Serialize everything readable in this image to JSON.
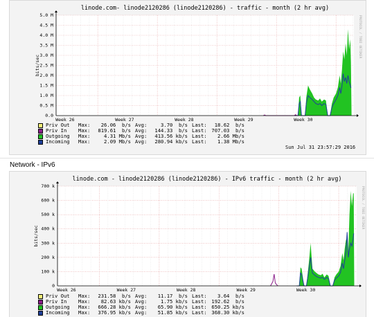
{
  "section_label": "Network - IPv6",
  "charts": [
    {
      "title": "linode.com- linode2120286 (linode2120286) - traffic - month (2 hr avg)",
      "side_text": "PROTOCOL / TOBI OETIKER",
      "ylabel": "bits/sec",
      "yticks": [
        "0.0",
        "0.5 M",
        "1.0 M",
        "1.5 M",
        "2.0 M",
        "2.5 M",
        "3.0 M",
        "3.5 M",
        "4.0 M",
        "4.5 M",
        "5.0 M"
      ],
      "xticks": [
        "Week 26",
        "Week 27",
        "Week 28",
        "Week 29",
        "Week 30"
      ],
      "timestamp": "Sun Jul 31 23:57:29 2016",
      "legend": [
        {
          "name": "Priv Out",
          "color": "#f5f27a",
          "max_k": "Max:",
          "max": "26.06  b/s",
          "avg_k": "Avg:",
          "avg": "3.70  b/s",
          "last_k": "Last:",
          "last": "18.62  b/s"
        },
        {
          "name": "Priv In",
          "color": "#8b1c88",
          "max_k": "Max:",
          "max": "819.61  b/s",
          "avg_k": "Avg:",
          "avg": "144.33  b/s",
          "last_k": "Last:",
          "last": "707.03  b/s"
        },
        {
          "name": "Outgoing",
          "color": "#22c322",
          "max_k": "Max:",
          "max": "4.31 Mb/s",
          "avg_k": "Avg:",
          "avg": "413.56 kb/s",
          "last_k": "Last:",
          "last": "2.66 Mb/s"
        },
        {
          "name": "Incoming",
          "color": "#1f3f9a",
          "max_k": "Max:",
          "max": "2.09 Mb/s",
          "avg_k": "Avg:",
          "avg": "280.94 kb/s",
          "last_k": "Last:",
          "last": "1.38 Mb/s"
        }
      ]
    },
    {
      "title": "linode.com - linode2120286 (linode2120286) - IPv6 traffic - month (2 hr avg)",
      "side_text": "PROTOCOL / TOBI OETIKER",
      "ylabel": "bits/sec",
      "yticks": [
        "0",
        "100 k",
        "200 k",
        "300 k",
        "400 k",
        "500 k",
        "600 k",
        "700 k"
      ],
      "xticks": [
        "Week 26",
        "Week 27",
        "Week 28",
        "Week 29",
        "Week 30"
      ],
      "timestamp": "",
      "legend": [
        {
          "name": "Priv Out",
          "color": "#f5f27a",
          "max_k": "Max:",
          "max": "231.58  b/s",
          "avg_k": "Avg:",
          "avg": "11.17  b/s",
          "last_k": "Last:",
          "last": "3.64  b/s"
        },
        {
          "name": "Priv In",
          "color": "#8b1c88",
          "max_k": "Max:",
          "max": "82.63 kb/s",
          "avg_k": "Avg:",
          "avg": "1.75 kb/s",
          "last_k": "Last:",
          "last": "192.62  b/s"
        },
        {
          "name": "Outgoing",
          "color": "#22c322",
          "max_k": "Max:",
          "max": "666.28 kb/s",
          "avg_k": "Avg:",
          "avg": "65.90 kb/s",
          "last_k": "Last:",
          "last": "650.25 kb/s"
        },
        {
          "name": "Incoming",
          "color": "#1f3f9a",
          "max_k": "Max:",
          "max": "376.95 kb/s",
          "avg_k": "Avg:",
          "avg": "51.85 kb/s",
          "last_k": "Last:",
          "last": "368.30 kb/s"
        }
      ]
    }
  ],
  "chart_data": [
    {
      "type": "area",
      "title": "linode.com- linode2120286 (linode2120286) - traffic - month (2 hr avg)",
      "ylabel": "bits/sec",
      "ylim": [
        0,
        5.0
      ],
      "y_unit": "M",
      "xlim": [
        25.3,
        30.3
      ],
      "x_unit": "week",
      "grid": true,
      "series": [
        {
          "name": "Outgoing",
          "color": "#22c322",
          "fill": true,
          "x": [
            29.3,
            29.36,
            29.38,
            29.4,
            29.42,
            29.48,
            29.5,
            29.53,
            29.56,
            29.6,
            29.63,
            29.66,
            29.7,
            29.73,
            29.76,
            29.8,
            29.83,
            29.86,
            29.9,
            29.93,
            29.96,
            30.0,
            30.03,
            30.06,
            30.08,
            30.1,
            30.12,
            30.14,
            30.16,
            30.18,
            30.2,
            30.22,
            30.24,
            30.25,
            30.26
          ],
          "y": [
            0,
            0,
            0.9,
            1.0,
            0,
            0,
            0.9,
            1.5,
            1.3,
            1.1,
            0.9,
            0.8,
            0.75,
            0.85,
            0.7,
            0.8,
            0.75,
            0,
            0,
            0.6,
            0.9,
            1.1,
            1.4,
            2.0,
            1.6,
            2.3,
            3.2,
            2.8,
            3.6,
            3.0,
            4.3,
            3.3,
            3.8,
            2.66,
            0
          ]
        },
        {
          "name": "Incoming",
          "color": "#1f3f9a",
          "fill": false,
          "x": [
            29.3,
            29.36,
            29.38,
            29.4,
            29.42,
            29.48,
            29.5,
            29.53,
            29.56,
            29.6,
            29.63,
            29.66,
            29.7,
            29.73,
            29.76,
            29.8,
            29.83,
            29.86,
            29.9,
            29.93,
            29.96,
            30.0,
            30.03,
            30.06,
            30.08,
            30.1,
            30.12,
            30.14,
            30.16,
            30.18,
            30.2,
            30.22,
            30.24,
            30.25
          ],
          "y": [
            0,
            0,
            0.6,
            0.7,
            0,
            0,
            0.6,
            1.0,
            0.9,
            0.8,
            0.7,
            0.6,
            0.55,
            0.6,
            0.5,
            0.6,
            0.55,
            0,
            0,
            0.4,
            0.6,
            0.8,
            1.0,
            1.4,
            1.1,
            1.5,
            2.09,
            1.7,
            1.9,
            1.6,
            2.0,
            1.7,
            1.5,
            1.38
          ]
        },
        {
          "name": "Priv In",
          "color": "#8b1c88",
          "fill": false,
          "x": [
            28.78,
            28.8,
            28.82,
            29.3,
            29.32,
            29.34
          ],
          "y": [
            0,
            0.03,
            0,
            0,
            0.05,
            0
          ]
        }
      ]
    },
    {
      "type": "area",
      "title": "linode.com - linode2120286 (linode2120286) - IPv6 traffic - month (2 hr avg)",
      "ylabel": "bits/sec",
      "ylim": [
        0,
        700
      ],
      "y_unit": "k",
      "xlim": [
        25.3,
        30.3
      ],
      "x_unit": "week",
      "grid": true,
      "series": [
        {
          "name": "Outgoing",
          "color": "#22c322",
          "fill": true,
          "x": [
            29.3,
            29.34,
            29.36,
            29.38,
            29.42,
            29.46,
            29.5,
            29.53,
            29.56,
            29.6,
            29.63,
            29.66,
            29.7,
            29.73,
            29.76,
            29.8,
            29.83,
            29.86,
            29.9,
            29.93,
            29.96,
            30.0,
            30.03,
            30.06,
            30.08,
            30.1,
            30.12,
            30.14,
            30.16,
            30.18,
            30.2,
            30.22,
            30.24,
            30.25,
            30.26
          ],
          "y": [
            0,
            0,
            130,
            120,
            0,
            0,
            160,
            300,
            120,
            100,
            90,
            80,
            75,
            85,
            60,
            80,
            70,
            0,
            0,
            60,
            80,
            100,
            140,
            230,
            180,
            260,
            320,
            340,
            230,
            500,
            666,
            560,
            650,
            650,
            0
          ]
        },
        {
          "name": "Incoming",
          "color": "#1f3f9a",
          "fill": false,
          "x": [
            29.3,
            29.34,
            29.36,
            29.38,
            29.42,
            29.46,
            29.5,
            29.53,
            29.56,
            29.6,
            29.63,
            29.66,
            29.7,
            29.73,
            29.76,
            29.8,
            29.83,
            29.86,
            29.9,
            29.93,
            29.96,
            30.0,
            30.03,
            30.06,
            30.08,
            30.1,
            30.12,
            30.14,
            30.16,
            30.18,
            30.2,
            30.22,
            30.24,
            30.25
          ],
          "y": [
            0,
            0,
            90,
            80,
            0,
            0,
            110,
            200,
            90,
            75,
            65,
            60,
            55,
            60,
            45,
            60,
            50,
            0,
            0,
            40,
            55,
            70,
            95,
            160,
            120,
            180,
            230,
            377,
            200,
            260,
            300,
            280,
            330,
            368
          ]
        },
        {
          "name": "Priv In",
          "color": "#8b1c88",
          "fill": false,
          "x": [
            28.86,
            28.9,
            28.92,
            28.94,
            28.98
          ],
          "y": [
            0,
            30,
            82,
            20,
            0
          ]
        }
      ]
    }
  ]
}
